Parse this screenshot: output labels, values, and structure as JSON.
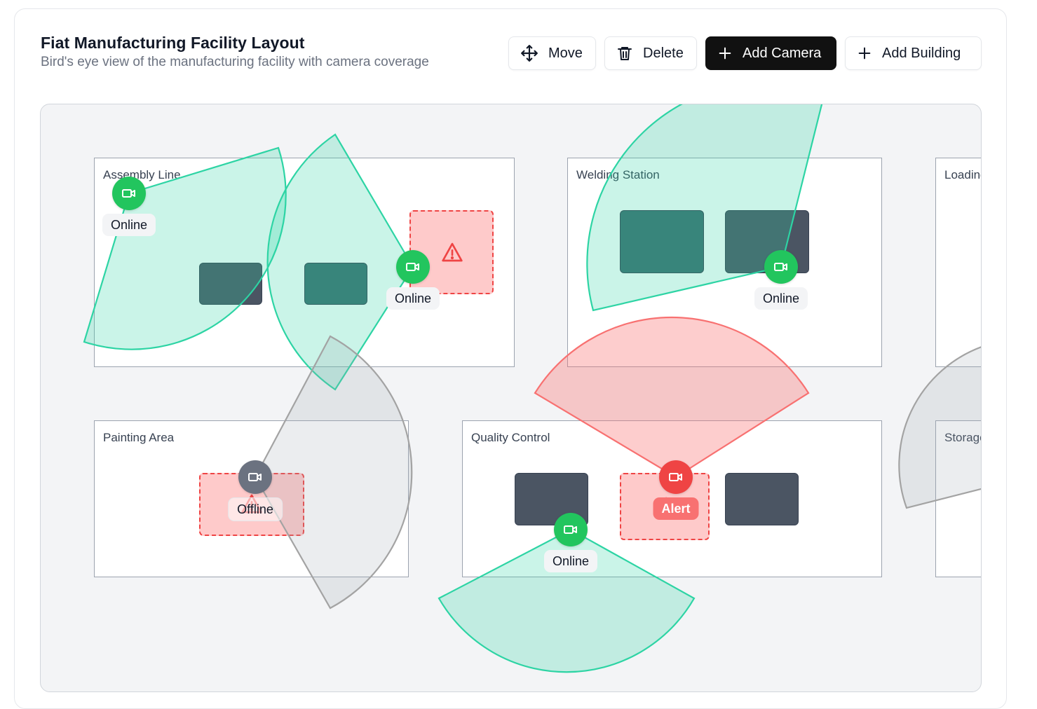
{
  "header": {
    "title": "Fiat Manufacturing Facility Layout",
    "subtitle": "Bird's eye view of the manufacturing facility with camera coverage"
  },
  "toolbar": {
    "move_label": "Move",
    "delete_label": "Delete",
    "add_camera_label": "Add Camera",
    "add_building_label": "Add Building"
  },
  "colors": {
    "accent": "#111111",
    "online": "#22c55e",
    "offline": "#6b7280",
    "alert": "#ef4444",
    "coverage_online": "#2dd4a4",
    "coverage_offline": "#9ca3af",
    "coverage_alert": "#f87171"
  },
  "buildings": [
    {
      "label": "Assembly Line"
    },
    {
      "label": "Welding Station"
    },
    {
      "label": "Loading Dock"
    },
    {
      "label": "Painting Area"
    },
    {
      "label": "Quality Control"
    },
    {
      "label": "Storage"
    }
  ],
  "cameras": [
    {
      "status": "online",
      "label": "Online",
      "icon": "video-camera-icon"
    },
    {
      "status": "online",
      "label": "Online",
      "icon": "video-camera-icon"
    },
    {
      "status": "online",
      "label": "Online",
      "icon": "video-camera-icon"
    },
    {
      "status": "offline",
      "label": "Offline",
      "icon": "video-camera-icon"
    },
    {
      "status": "alert",
      "label": "Alert",
      "icon": "video-camera-icon"
    },
    {
      "status": "online",
      "label": "Online",
      "icon": "video-camera-icon"
    }
  ],
  "icons": {
    "move": "move-arrows-icon",
    "delete": "trash-icon",
    "add": "plus-icon",
    "hazard": "warning-triangle-icon",
    "camera": "video-camera-icon"
  }
}
